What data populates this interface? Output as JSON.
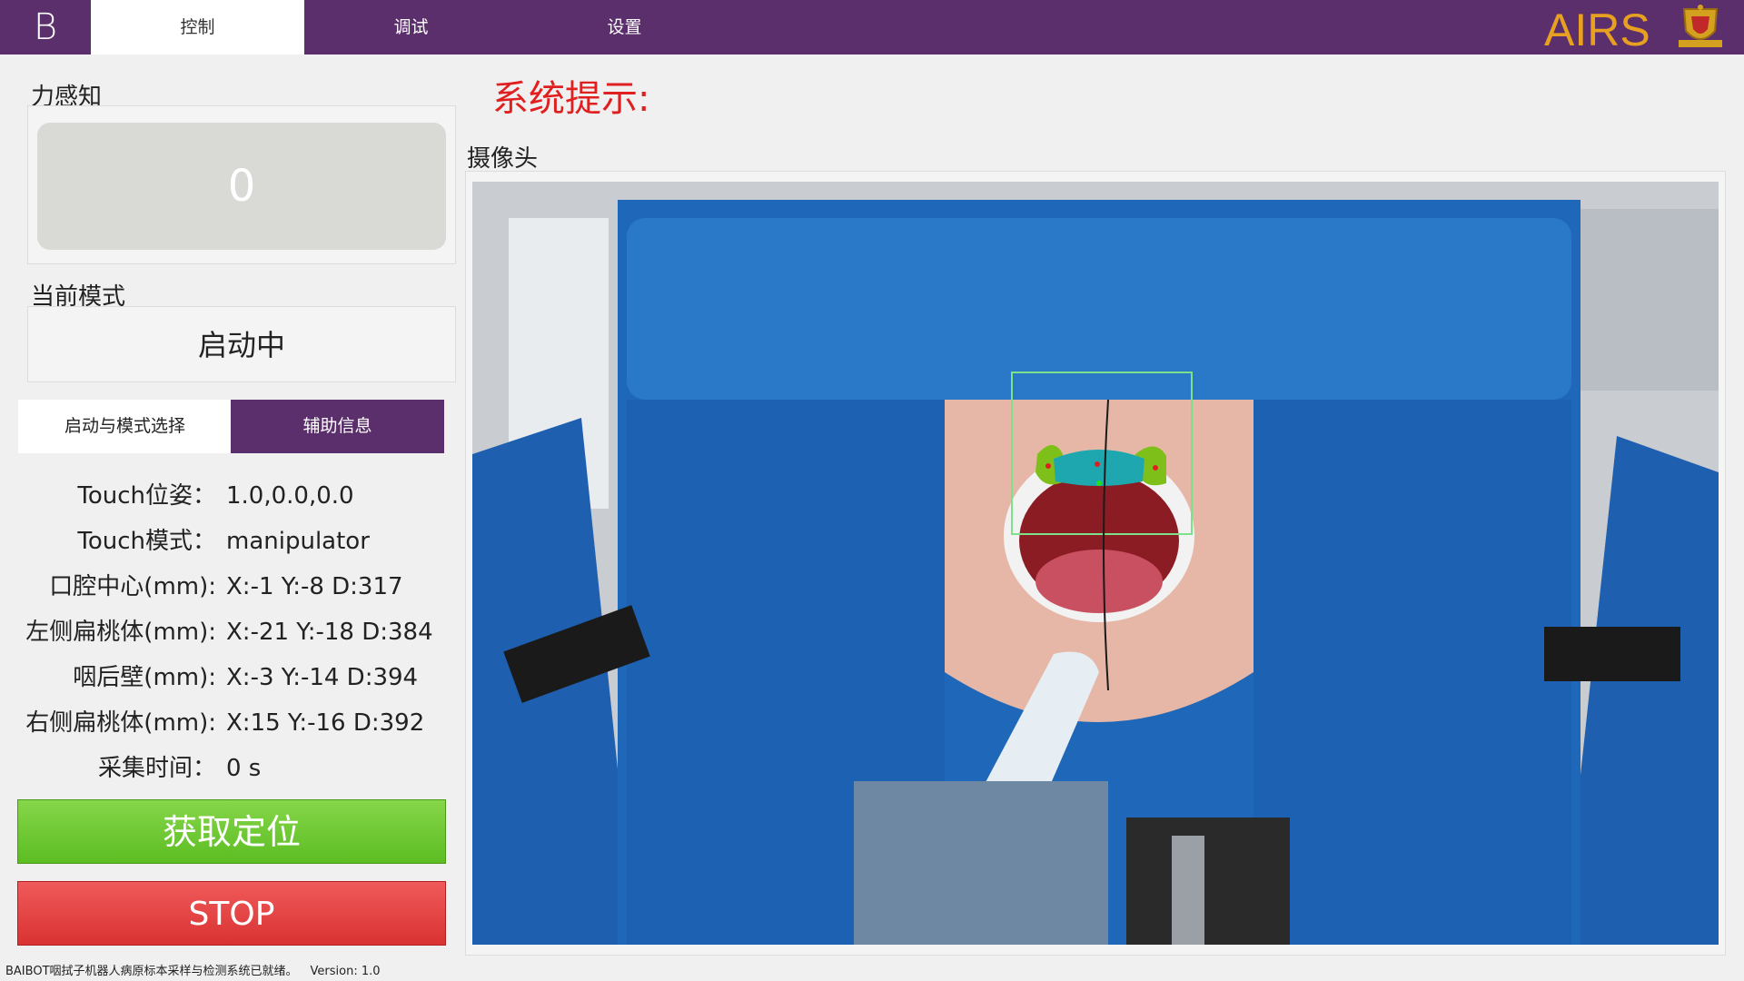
{
  "header": {
    "logo_letter": "B",
    "tabs": [
      "控制",
      "调试",
      "设置"
    ],
    "active_tab": 0,
    "brand_text": "AIRS"
  },
  "force": {
    "label": "力感知",
    "value": "0"
  },
  "mode": {
    "label": "当前模式",
    "value": "启动中"
  },
  "subtabs": {
    "start": "启动与模式选择",
    "info": "辅助信息"
  },
  "info_rows": [
    {
      "key": "Touch位姿：",
      "value": "1.0,0.0,0.0"
    },
    {
      "key": "Touch模式：",
      "value": "manipulator"
    },
    {
      "key": "口腔中心(mm):",
      "value": "X:-1 Y:-8 D:317"
    },
    {
      "key": "左侧扁桃体(mm):",
      "value": "X:-21 Y:-18 D:384"
    },
    {
      "key": "咽后壁(mm):",
      "value": "X:-3 Y:-14 D:394"
    },
    {
      "key": "右侧扁桃体(mm):",
      "value": "X:15 Y:-16 D:392"
    },
    {
      "key": "采集时间：",
      "value": "0 s"
    }
  ],
  "buttons": {
    "locate": "获取定位",
    "stop": "STOP"
  },
  "system_prompt": {
    "title": "系统提示:"
  },
  "camera": {
    "label": "摄像头"
  },
  "status": {
    "message": "BAIBOT咽拭子机器人病原标本采样与检测系统已就绪。",
    "version": "Version: 1.0"
  },
  "colors": {
    "brand_purple": "#5b2f6b",
    "locate_green": "#6cc832",
    "stop_red": "#e04040",
    "prompt_red": "#e02020"
  }
}
